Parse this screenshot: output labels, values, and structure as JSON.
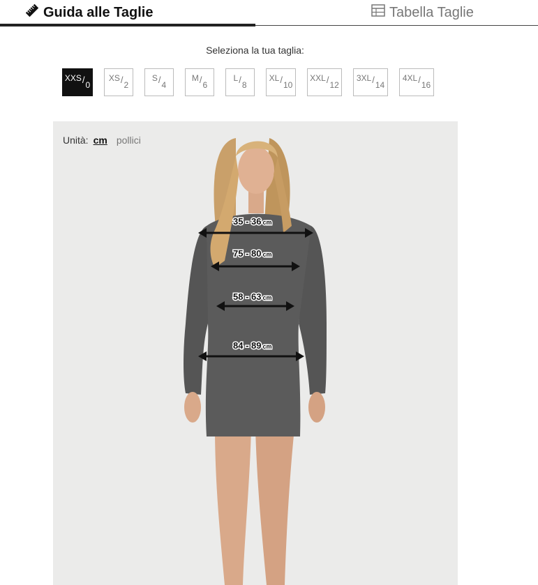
{
  "tabs": {
    "guide_label": "Guida alle Taglie",
    "guide_icon": "ruler-icon",
    "table_label": "Tabella Taglie",
    "table_icon": "table-icon"
  },
  "size_selector": {
    "label": "Seleziona la tua taglia:",
    "selected": "XXS/0",
    "sizes": [
      {
        "top": "XXS",
        "bottom": "0"
      },
      {
        "top": "XS",
        "bottom": "2"
      },
      {
        "top": "S",
        "bottom": "4"
      },
      {
        "top": "M",
        "bottom": "6"
      },
      {
        "top": "L",
        "bottom": "8"
      },
      {
        "top": "XL",
        "bottom": "10"
      },
      {
        "top": "XXL",
        "bottom": "12"
      },
      {
        "top": "3XL",
        "bottom": "14"
      },
      {
        "top": "4XL",
        "bottom": "16"
      }
    ]
  },
  "units": {
    "label": "Unità:",
    "cm": "cm",
    "inches": "pollici",
    "selected": "cm"
  },
  "measurements": [
    {
      "value": "35 - 36",
      "unit": "cm"
    },
    {
      "value": "75 - 80",
      "unit": "cm"
    },
    {
      "value": "58 - 63",
      "unit": "cm"
    },
    {
      "value": "84 - 89",
      "unit": "cm"
    }
  ],
  "colors": {
    "active": "#111111",
    "panel_bg": "#ebebea",
    "dress": "#5b5b5b"
  }
}
